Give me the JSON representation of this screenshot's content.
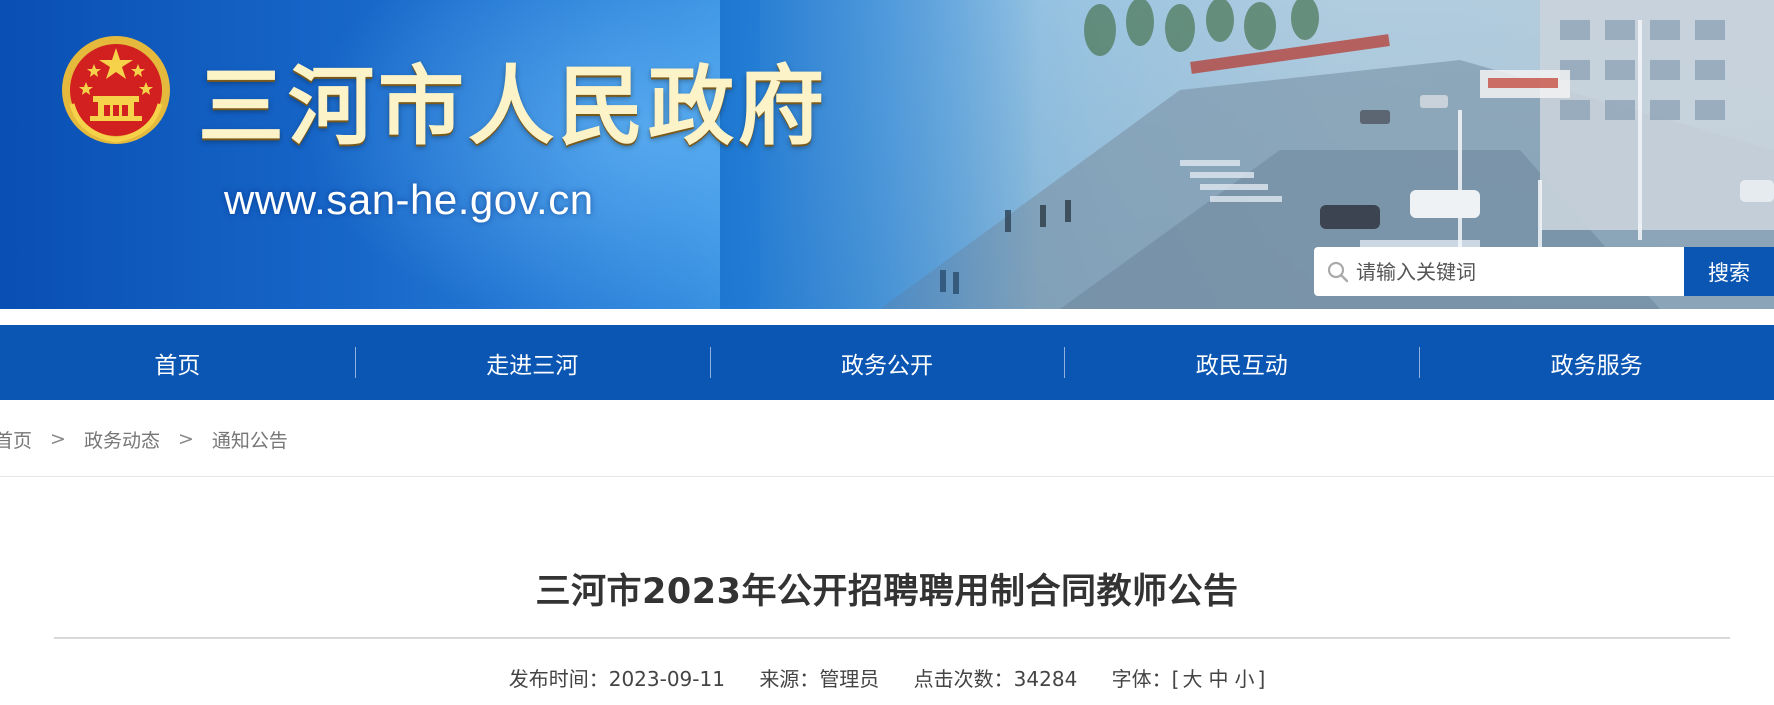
{
  "header": {
    "site_title": "三河市人民政府",
    "site_url": "www.san-he.gov.cn",
    "emblem_icon": "national-emblem-icon",
    "colors": {
      "banner_blue": "#1767c9",
      "title_text": "#fdf3c8",
      "nav_blue": "#0b56b3"
    }
  },
  "search": {
    "placeholder": "请输入关键词",
    "button_label": "搜索",
    "icon": "search-icon"
  },
  "nav": {
    "items": [
      {
        "label": "首页"
      },
      {
        "label": "走进三河"
      },
      {
        "label": "政务公开"
      },
      {
        "label": "政民互动"
      },
      {
        "label": "政务服务"
      }
    ]
  },
  "breadcrumb": {
    "items": [
      "首页",
      "政务动态",
      "通知公告"
    ],
    "separator": ">"
  },
  "article": {
    "title": "三河市2023年公开招聘聘用制合同教师公告",
    "meta": {
      "date_label": "发布时间：",
      "date": "2023-09-11",
      "source_label": "来源：",
      "source": "管理员",
      "views_label": "点击次数：",
      "views": "34284",
      "font_label": "字体：",
      "font_open": "[",
      "font_large": "大",
      "font_medium": "中",
      "font_small": "小",
      "font_close": "]"
    }
  }
}
